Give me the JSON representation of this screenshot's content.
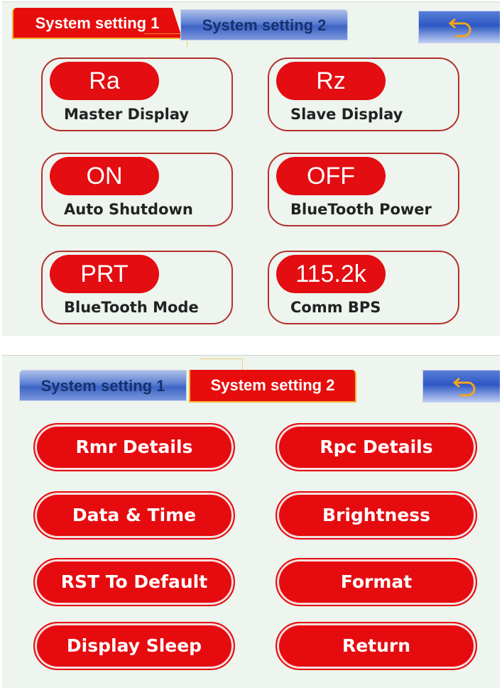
{
  "colors": {
    "accent_red": "#e30d12",
    "tab_blue": "#3d63c4",
    "panel_bg": "#eef4ee",
    "card_border": "#b2302b"
  },
  "screen1": {
    "tabs": [
      {
        "label": "System setting 1",
        "active": true
      },
      {
        "label": "System setting 2",
        "active": false
      }
    ],
    "back_icon": "return-arrow-icon",
    "settings": [
      {
        "value": "Ra",
        "label": "Master Display"
      },
      {
        "value": "Rz",
        "label": "Slave Display"
      },
      {
        "value": "ON",
        "label": "Auto Shutdown"
      },
      {
        "value": "OFF",
        "label": "BlueTooth Power"
      },
      {
        "value": "PRT",
        "label": "BlueTooth Mode"
      },
      {
        "value": "115.2k",
        "label": "Comm BPS"
      }
    ]
  },
  "screen2": {
    "tabs": [
      {
        "label": "System setting 1",
        "active": false
      },
      {
        "label": "System setting 2",
        "active": true
      }
    ],
    "back_icon": "return-arrow-icon",
    "buttons": [
      "Rmr Details",
      "Rpc Details",
      "Data & Time",
      "Brightness",
      "RST To Default",
      "Format",
      "Display Sleep",
      "Return"
    ]
  }
}
